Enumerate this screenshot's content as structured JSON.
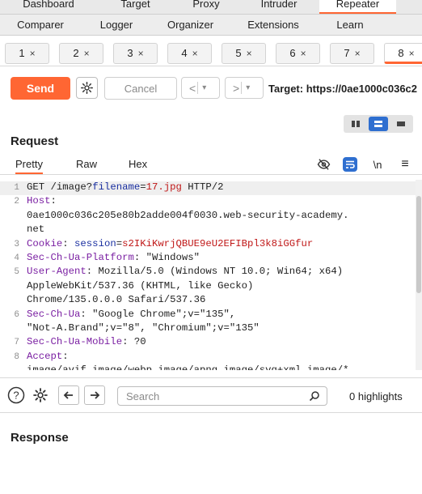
{
  "top_nav": {
    "tabs": [
      {
        "label": "Dashboard",
        "w": 120
      },
      {
        "label": "Target",
        "w": 95
      },
      {
        "label": "Proxy",
        "w": 80
      },
      {
        "label": "Intruder",
        "w": 100
      },
      {
        "label": "Repeater",
        "w": 95,
        "active": true
      }
    ]
  },
  "sub_nav": {
    "tabs": [
      "Comparer",
      "Logger",
      "Organizer",
      "Extensions",
      "Learn"
    ]
  },
  "request_tabs": [
    {
      "label": "1",
      "close": "×"
    },
    {
      "label": "2",
      "close": "×"
    },
    {
      "label": "3",
      "close": "×"
    },
    {
      "label": "4",
      "close": "×"
    },
    {
      "label": "5",
      "close": "×"
    },
    {
      "label": "6",
      "close": "×"
    },
    {
      "label": "7",
      "close": "×"
    },
    {
      "label": "8",
      "close": "×",
      "active": true
    }
  ],
  "toolbar": {
    "send_label": "Send",
    "cancel_label": "Cancel",
    "back_arrow": "<",
    "forward_arrow": ">",
    "dropdown": "▾",
    "target_text": "Target: https://0ae1000c036c2"
  },
  "request": {
    "title": "Request",
    "tabs": [
      "Pretty",
      "Raw",
      "Hex"
    ],
    "newline_label": "\\n",
    "menu_icon": "≡",
    "line_numbers": [
      "1",
      "2",
      "3",
      "4",
      "5",
      "6",
      "7",
      "8"
    ],
    "lines": [
      {
        "html": "GET /image?<span class=\"h\">filename</span>=<span class=\"v\">17.jpg</span> HTTP/2"
      },
      {
        "html": "<span class=\"k\">Host</span>:"
      },
      {
        "html": "0ae1000c036c205e80b2adde004f0030.web-security-academy."
      },
      {
        "html": "net"
      },
      {
        "html": "<span class=\"k\">Cookie</span>: <span class=\"h\">session</span>=<span class=\"v\">s2IKiKwrjQBUE9eU2EFIBpl3k8iGGfur</span>"
      },
      {
        "html": "<span class=\"k\">Sec-Ch-Ua-Platform</span>: \"Windows\""
      },
      {
        "html": "<span class=\"k\">User-Agent</span>: Mozilla/5.0 (Windows NT 10.0; Win64; x64)"
      },
      {
        "html": "AppleWebKit/537.36 (KHTML, like Gecko)"
      },
      {
        "html": "Chrome/135.0.0.0 Safari/537.36"
      },
      {
        "html": "<span class=\"k\">Sec-Ch-Ua</span>: \"Google Chrome\";v=\"135\","
      },
      {
        "html": "\"Not-A.Brand\";v=\"8\", \"Chromium\";v=\"135\""
      },
      {
        "html": "<span class=\"k\">Sec-Ch-Ua-Mobile</span>: ?0"
      },
      {
        "html": "<span class=\"k\">Accept</span>:"
      },
      {
        "html": "image/avif,image/webp,image/apng,image/svg+xml,image/*"
      }
    ]
  },
  "search": {
    "placeholder": "Search",
    "highlights": "0 highlights"
  },
  "response": {
    "title": "Response"
  },
  "colors": {
    "accent": "#ff6633",
    "toggle_selected": "#2f6fd0",
    "header_name": "#7a1fa2",
    "param_value": "#c01818",
    "param_name": "#1a2fa0"
  }
}
